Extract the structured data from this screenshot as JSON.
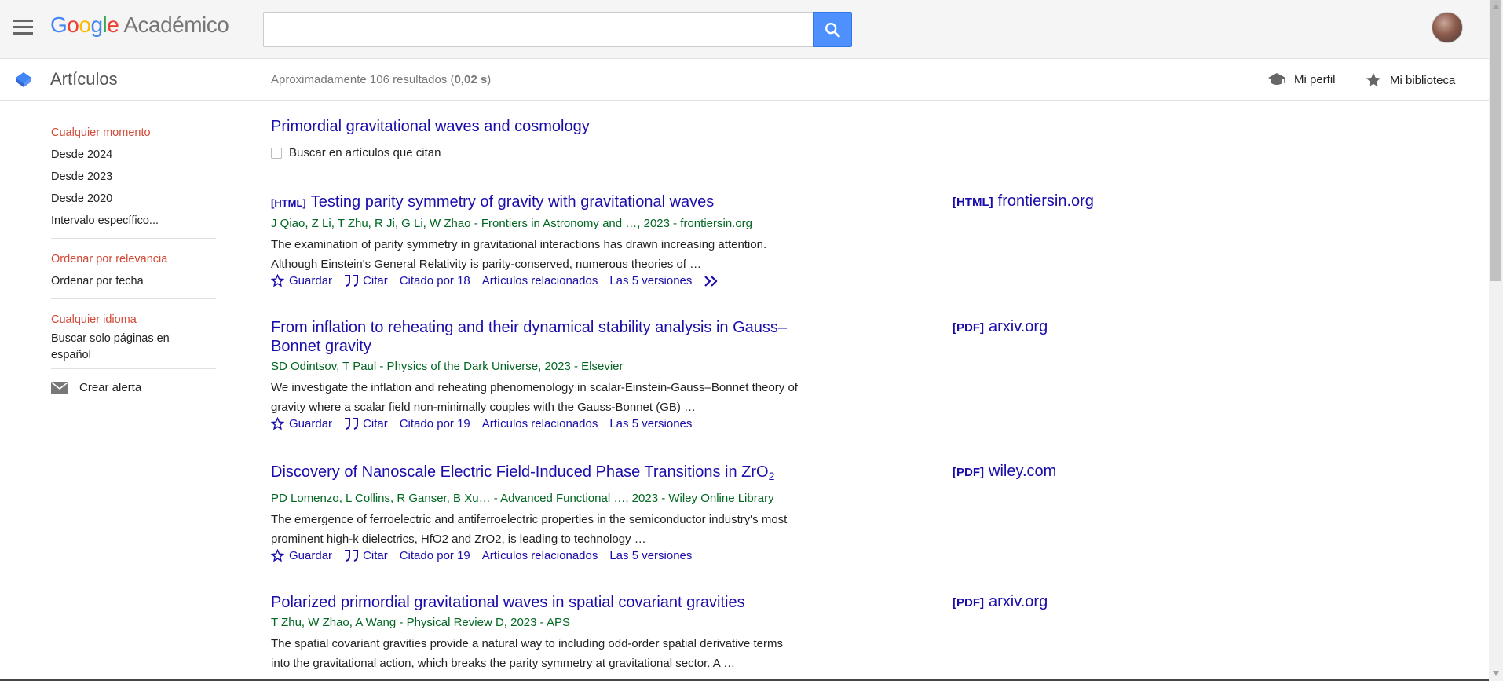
{
  "header": {
    "logo_google": [
      "G",
      "o",
      "o",
      "g",
      "l",
      "e"
    ],
    "logo_product": "Académico",
    "search_value": "",
    "search_placeholder": ""
  },
  "subheader": {
    "section_label": "Artículos",
    "results_prefix": "Aproximadamente 106 resultados (",
    "results_time": "0,02 s",
    "results_suffix": ")",
    "profile_label": "Mi perfil",
    "library_label": "Mi biblioteca"
  },
  "sidebar": {
    "time_filters": [
      {
        "label": "Cualquier momento",
        "active": true
      },
      {
        "label": "Desde 2024",
        "active": false
      },
      {
        "label": "Desde 2023",
        "active": false
      },
      {
        "label": "Desde 2020",
        "active": false
      },
      {
        "label": "Intervalo específico...",
        "active": false
      }
    ],
    "sort_filters": [
      {
        "label": "Ordenar por relevancia",
        "active": true
      },
      {
        "label": "Ordenar por fecha",
        "active": false
      }
    ],
    "lang_filters": [
      {
        "label": "Cualquier idioma",
        "active": true
      },
      {
        "label": "Buscar solo páginas en español",
        "active": false
      }
    ],
    "alert_label": "Crear alerta"
  },
  "query": {
    "title": "Primordial gravitational waves and cosmology",
    "cite_search_label": "Buscar en artículos que citan"
  },
  "results": [
    {
      "type": "[HTML]",
      "title": "Testing parity symmetry of gravity with gravitational waves",
      "authors": "J Qiao, Z Li, T Zhu, R Ji, G Li, W Zhao - Frontiers in Astronomy and …, 2023 - frontiersin.org",
      "snippet": "The examination of parity symmetry in gravitational interactions has drawn increasing attention. Although Einstein's General Relativity is parity-conserved, numerous theories of …",
      "save": "Guardar",
      "cite": "Citar",
      "cited_by": "Citado por 18",
      "related": "Artículos relacionados",
      "versions": "Las 5 versiones",
      "side_type": "[HTML]",
      "side_source": "frontiersin.org"
    },
    {
      "type": "",
      "title": "From inflation to reheating and their dynamical stability analysis in Gauss–Bonnet gravity",
      "authors": "SD Odintsov, T Paul - Physics of the Dark Universe, 2023 - Elsevier",
      "snippet": "We investigate the inflation and reheating phenomenology in scalar-Einstein-Gauss–Bonnet theory of gravity where a scalar field non-minimally couples with the Gauss-Bonnet (GB) …",
      "save": "Guardar",
      "cite": "Citar",
      "cited_by": "Citado por 19",
      "related": "Artículos relacionados",
      "versions": "Las 5 versiones",
      "side_type": "[PDF]",
      "side_source": "arxiv.org"
    },
    {
      "type": "",
      "title": "Discovery of Nanoscale Electric Field-Induced Phase Transitions in ZrO",
      "title_sub": "2",
      "authors": "PD Lomenzo, L Collins, R Ganser, B Xu… - Advanced Functional …, 2023 - Wiley Online Library",
      "snippet": "The emergence of ferroelectric and antiferroelectric properties in the semiconductor industry's most prominent high-k dielectrics, HfO2 and ZrO2, is leading to technology …",
      "save": "Guardar",
      "cite": "Citar",
      "cited_by": "Citado por 19",
      "related": "Artículos relacionados",
      "versions": "Las 5 versiones",
      "side_type": "[PDF]",
      "side_source": "wiley.com"
    },
    {
      "type": "",
      "title": "Polarized primordial gravitational waves in spatial covariant gravities",
      "authors": "T Zhu, W Zhao, A Wang - Physical Review D, 2023 - APS",
      "snippet": "The spatial covariant gravities provide a natural way to including odd-order spatial derivative terms into the gravitational action, which breaks the parity symmetry at gravitational sector. A …",
      "side_type": "[PDF]",
      "side_source": "arxiv.org"
    }
  ],
  "colors": {
    "link": "#1a0dab",
    "author_green": "#006621",
    "active_red": "#d14836",
    "search_blue": "#4d90fe"
  }
}
